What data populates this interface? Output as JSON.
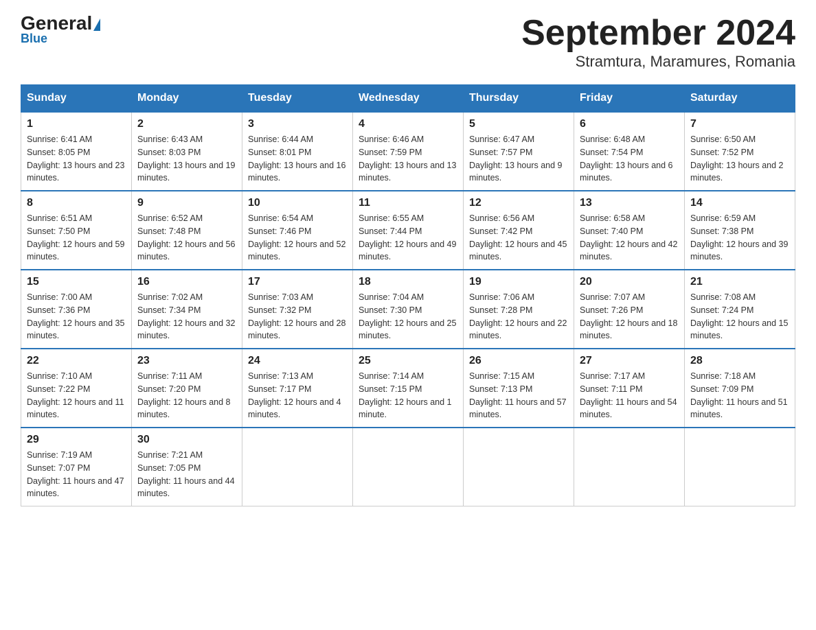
{
  "header": {
    "logo_general": "General",
    "logo_blue": "Blue",
    "title": "September 2024",
    "subtitle": "Stramtura, Maramures, Romania"
  },
  "days_of_week": [
    "Sunday",
    "Monday",
    "Tuesday",
    "Wednesday",
    "Thursday",
    "Friday",
    "Saturday"
  ],
  "weeks": [
    [
      {
        "day": "1",
        "sunrise": "6:41 AM",
        "sunset": "8:05 PM",
        "daylight": "13 hours and 23 minutes."
      },
      {
        "day": "2",
        "sunrise": "6:43 AM",
        "sunset": "8:03 PM",
        "daylight": "13 hours and 19 minutes."
      },
      {
        "day": "3",
        "sunrise": "6:44 AM",
        "sunset": "8:01 PM",
        "daylight": "13 hours and 16 minutes."
      },
      {
        "day": "4",
        "sunrise": "6:46 AM",
        "sunset": "7:59 PM",
        "daylight": "13 hours and 13 minutes."
      },
      {
        "day": "5",
        "sunrise": "6:47 AM",
        "sunset": "7:57 PM",
        "daylight": "13 hours and 9 minutes."
      },
      {
        "day": "6",
        "sunrise": "6:48 AM",
        "sunset": "7:54 PM",
        "daylight": "13 hours and 6 minutes."
      },
      {
        "day": "7",
        "sunrise": "6:50 AM",
        "sunset": "7:52 PM",
        "daylight": "13 hours and 2 minutes."
      }
    ],
    [
      {
        "day": "8",
        "sunrise": "6:51 AM",
        "sunset": "7:50 PM",
        "daylight": "12 hours and 59 minutes."
      },
      {
        "day": "9",
        "sunrise": "6:52 AM",
        "sunset": "7:48 PM",
        "daylight": "12 hours and 56 minutes."
      },
      {
        "day": "10",
        "sunrise": "6:54 AM",
        "sunset": "7:46 PM",
        "daylight": "12 hours and 52 minutes."
      },
      {
        "day": "11",
        "sunrise": "6:55 AM",
        "sunset": "7:44 PM",
        "daylight": "12 hours and 49 minutes."
      },
      {
        "day": "12",
        "sunrise": "6:56 AM",
        "sunset": "7:42 PM",
        "daylight": "12 hours and 45 minutes."
      },
      {
        "day": "13",
        "sunrise": "6:58 AM",
        "sunset": "7:40 PM",
        "daylight": "12 hours and 42 minutes."
      },
      {
        "day": "14",
        "sunrise": "6:59 AM",
        "sunset": "7:38 PM",
        "daylight": "12 hours and 39 minutes."
      }
    ],
    [
      {
        "day": "15",
        "sunrise": "7:00 AM",
        "sunset": "7:36 PM",
        "daylight": "12 hours and 35 minutes."
      },
      {
        "day": "16",
        "sunrise": "7:02 AM",
        "sunset": "7:34 PM",
        "daylight": "12 hours and 32 minutes."
      },
      {
        "day": "17",
        "sunrise": "7:03 AM",
        "sunset": "7:32 PM",
        "daylight": "12 hours and 28 minutes."
      },
      {
        "day": "18",
        "sunrise": "7:04 AM",
        "sunset": "7:30 PM",
        "daylight": "12 hours and 25 minutes."
      },
      {
        "day": "19",
        "sunrise": "7:06 AM",
        "sunset": "7:28 PM",
        "daylight": "12 hours and 22 minutes."
      },
      {
        "day": "20",
        "sunrise": "7:07 AM",
        "sunset": "7:26 PM",
        "daylight": "12 hours and 18 minutes."
      },
      {
        "day": "21",
        "sunrise": "7:08 AM",
        "sunset": "7:24 PM",
        "daylight": "12 hours and 15 minutes."
      }
    ],
    [
      {
        "day": "22",
        "sunrise": "7:10 AM",
        "sunset": "7:22 PM",
        "daylight": "12 hours and 11 minutes."
      },
      {
        "day": "23",
        "sunrise": "7:11 AM",
        "sunset": "7:20 PM",
        "daylight": "12 hours and 8 minutes."
      },
      {
        "day": "24",
        "sunrise": "7:13 AM",
        "sunset": "7:17 PM",
        "daylight": "12 hours and 4 minutes."
      },
      {
        "day": "25",
        "sunrise": "7:14 AM",
        "sunset": "7:15 PM",
        "daylight": "12 hours and 1 minute."
      },
      {
        "day": "26",
        "sunrise": "7:15 AM",
        "sunset": "7:13 PM",
        "daylight": "11 hours and 57 minutes."
      },
      {
        "day": "27",
        "sunrise": "7:17 AM",
        "sunset": "7:11 PM",
        "daylight": "11 hours and 54 minutes."
      },
      {
        "day": "28",
        "sunrise": "7:18 AM",
        "sunset": "7:09 PM",
        "daylight": "11 hours and 51 minutes."
      }
    ],
    [
      {
        "day": "29",
        "sunrise": "7:19 AM",
        "sunset": "7:07 PM",
        "daylight": "11 hours and 47 minutes."
      },
      {
        "day": "30",
        "sunrise": "7:21 AM",
        "sunset": "7:05 PM",
        "daylight": "11 hours and 44 minutes."
      },
      null,
      null,
      null,
      null,
      null
    ]
  ],
  "labels": {
    "sunrise": "Sunrise:",
    "sunset": "Sunset:",
    "daylight": "Daylight:"
  }
}
